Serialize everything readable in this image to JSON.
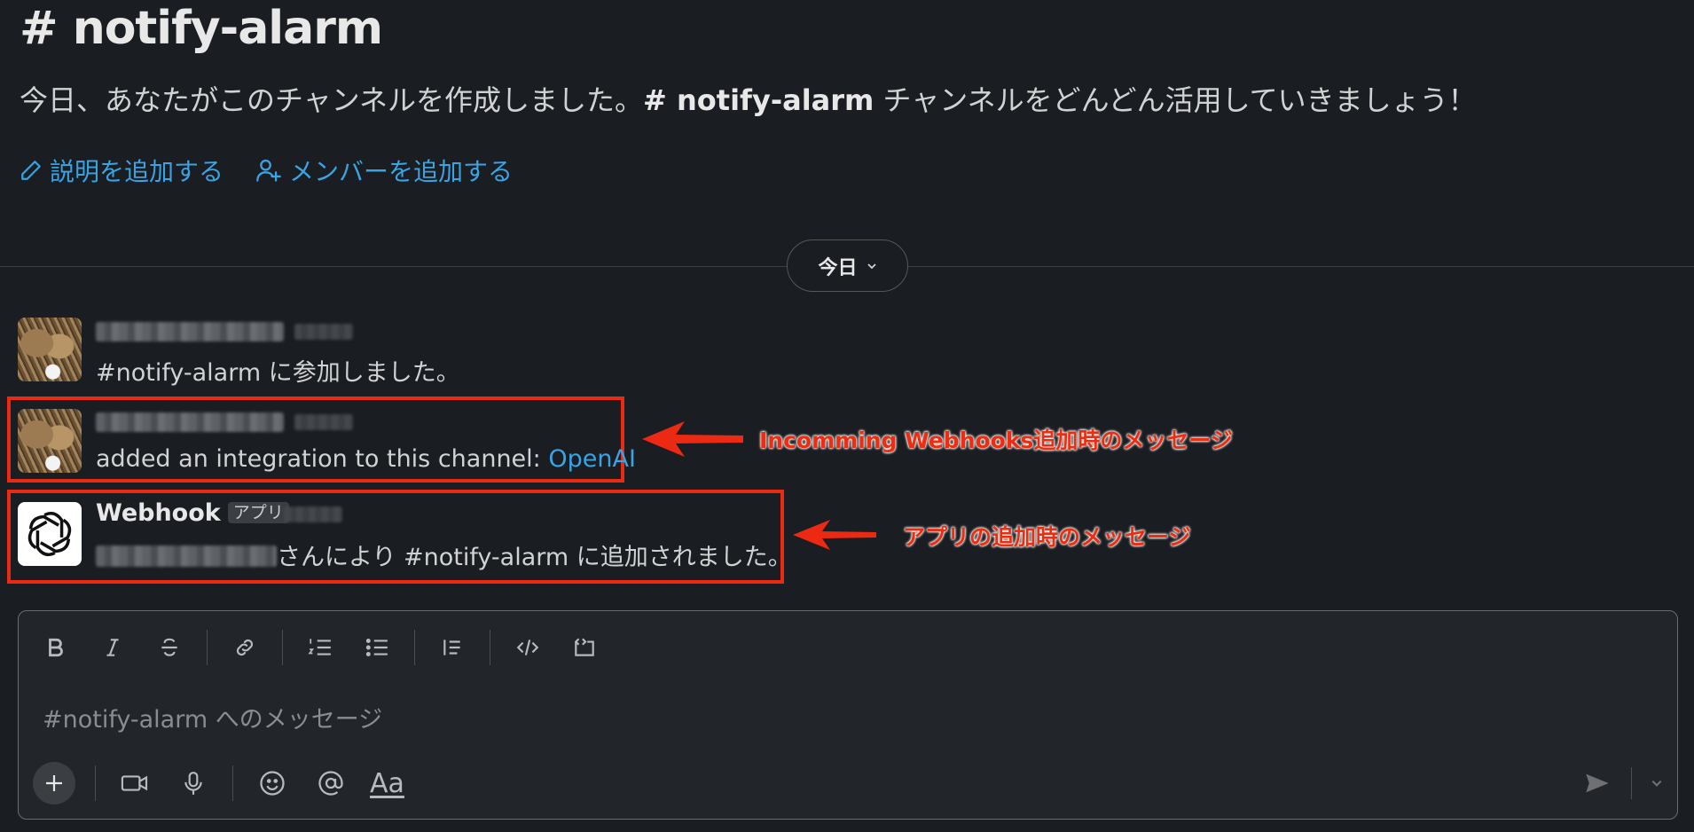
{
  "channel": {
    "hash": "#",
    "name": "notify-alarm",
    "intro_prefix": "今日、あなたがこのチャンネルを作成しました。",
    "intro_channel": "# notify-alarm",
    "intro_suffix": " チャンネルをどんどん活用していきましょう！",
    "add_description": "説明を追加する",
    "add_members": "メンバーを追加する"
  },
  "divider": {
    "label": "今日"
  },
  "messages": [
    {
      "text": "#notify-alarm に参加しました。"
    },
    {
      "text_prefix": "added an integration to this channel: ",
      "link": "OpenAI"
    },
    {
      "sender": "Webhook",
      "badge": "アプリ",
      "text": "さんにより #notify-alarm に追加されました。"
    }
  ],
  "annotations": {
    "webhook_note": "Incomming Webhooks追加時のメッセージ",
    "app_note": "アプリの追加時のメッセージ",
    "color": "#ec2a14"
  },
  "composer": {
    "placeholder": "#notify-alarm へのメッセージ",
    "format_label": "Aa",
    "toolbar_icons": [
      "bold-icon",
      "italic-icon",
      "strikethrough-icon",
      "link-icon",
      "ordered-list-icon",
      "bullet-list-icon",
      "blockquote-icon",
      "code-icon",
      "code-block-icon"
    ]
  },
  "colors": {
    "background": "#1a1d21",
    "link": "#3aa3e3"
  }
}
